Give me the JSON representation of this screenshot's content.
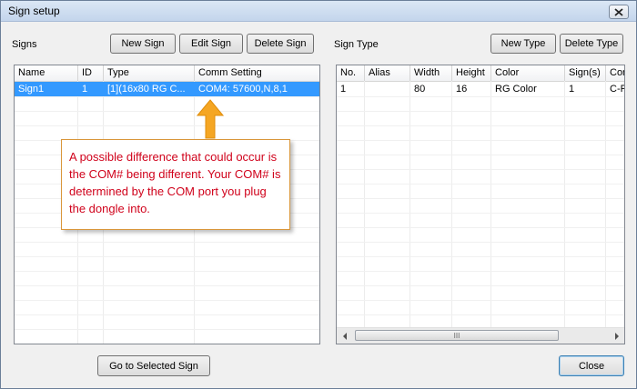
{
  "window": {
    "title": "Sign setup"
  },
  "signs": {
    "label": "Signs",
    "buttons": {
      "new": "New Sign",
      "edit": "Edit Sign",
      "delete": "Delete Sign"
    },
    "columns": [
      "Name",
      "ID",
      "Type",
      "Comm Setting"
    ],
    "rows": [
      {
        "name": "Sign1",
        "id": "1",
        "type": "[1](16x80 RG C...",
        "comm": "COM4: 57600,N,8,1"
      }
    ]
  },
  "sign_type": {
    "label": "Sign Type",
    "buttons": {
      "new": "New Type",
      "delete": "Delete Type"
    },
    "columns": [
      "No.",
      "Alias",
      "Width",
      "Height",
      "Color",
      "Sign(s)",
      "Cor"
    ],
    "rows": [
      {
        "no": "1",
        "alias": "",
        "width": "80",
        "height": "16",
        "color": "RG Color",
        "signs": "1",
        "cor": "C-P"
      }
    ],
    "scroll_thumb_glyph": "III"
  },
  "callout": {
    "text": "A possible difference that could occur is the COM# being different. Your COM# is determined by the COM port you plug the dongle into.",
    "color": "#d0021b",
    "arrow_color": "#f5a623"
  },
  "footer": {
    "go_to_selected": "Go to Selected Sign",
    "close": "Close"
  }
}
